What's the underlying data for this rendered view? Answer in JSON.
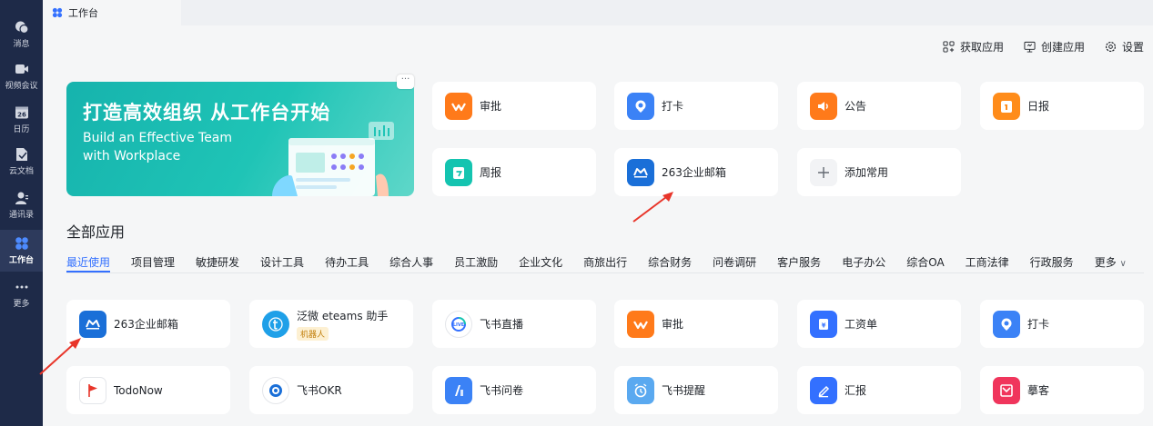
{
  "sidebar": {
    "items": [
      {
        "label": "消息",
        "icon": "chat-icon"
      },
      {
        "label": "视频会议",
        "icon": "video-icon"
      },
      {
        "label": "日历",
        "icon": "calendar-icon",
        "icon_text": "26"
      },
      {
        "label": "云文档",
        "icon": "doc-icon"
      },
      {
        "label": "通讯录",
        "icon": "contacts-icon"
      },
      {
        "label": "工作台",
        "icon": "workbench-icon",
        "active": true
      },
      {
        "label": "更多",
        "icon": "more-dots-icon"
      }
    ]
  },
  "tab": {
    "label": "工作台"
  },
  "top_actions": {
    "get_app": "获取应用",
    "create_app": "创建应用",
    "settings": "设置"
  },
  "banner": {
    "title": "打造高效组织 从工作台开始",
    "subtitle_line1": "Build an Effective Team",
    "subtitle_line2": "with Workplace",
    "more": "···"
  },
  "common_apps": [
    {
      "name": "审批",
      "color": "#ff7a1a"
    },
    {
      "name": "打卡",
      "color": "#3b82f6"
    },
    {
      "name": "公告",
      "color": "#ff7a1a"
    },
    {
      "name": "日报",
      "color": "#ff8c1a"
    },
    {
      "name": "周报",
      "color": "#14c4b0"
    },
    {
      "name": "263企业邮箱",
      "color": "#1a6fd8"
    },
    {
      "name": "添加常用",
      "color": "#f2f3f5"
    }
  ],
  "section_title": "全部应用",
  "categories": [
    "最近使用",
    "项目管理",
    "敏捷研发",
    "设计工具",
    "待办工具",
    "综合人事",
    "员工激励",
    "企业文化",
    "商旅出行",
    "综合财务",
    "问卷调研",
    "客户服务",
    "电子办公",
    "综合OA",
    "工商法律",
    "行政服务",
    "更多"
  ],
  "all_apps": [
    {
      "name": "263企业邮箱",
      "color": "#1a6fd8"
    },
    {
      "name": "泛微 eteams 助手",
      "sub": "机器人",
      "color": "#1fa0e8"
    },
    {
      "name": "飞书直播",
      "color": "#ffffff"
    },
    {
      "name": "审批",
      "color": "#ff7a1a"
    },
    {
      "name": "工资单",
      "color": "#3370ff"
    },
    {
      "name": "打卡",
      "color": "#3b82f6"
    },
    {
      "name": "TodoNow",
      "color": "#ffffff"
    },
    {
      "name": "飞书OKR",
      "color": "#ffffff"
    },
    {
      "name": "飞书问卷",
      "color": "#3b82f6"
    },
    {
      "name": "飞书提醒",
      "color": "#5aa9f0"
    },
    {
      "name": "汇报",
      "color": "#3370ff"
    },
    {
      "name": "摹客",
      "color": "#f0355c"
    }
  ],
  "colors": {
    "accent": "#3370ff",
    "sidebar_bg": "#1e2a48",
    "annotation": "#e8352a"
  }
}
